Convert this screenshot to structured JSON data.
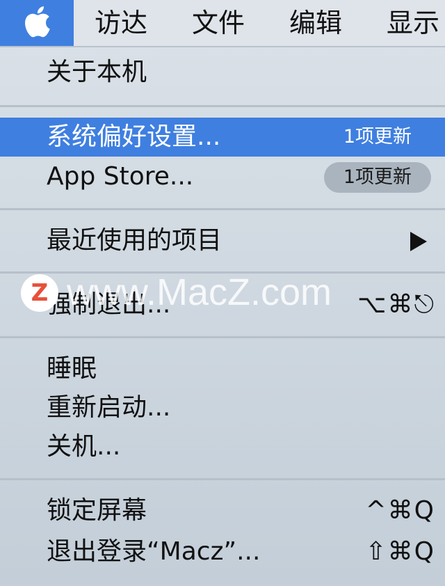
{
  "menubar": {
    "apple_icon": "apple-logo-icon",
    "items": [
      "访达",
      "文件",
      "编辑",
      "显示"
    ]
  },
  "apple_menu": {
    "about": "关于本机",
    "system_prefs": {
      "label": "系统偏好设置...",
      "badge": "1项更新"
    },
    "app_store": {
      "label": "App Store...",
      "badge": "1项更新"
    },
    "recent_items": {
      "label": "最近使用的项目",
      "submenu_icon": "triangle-right-icon"
    },
    "force_quit": {
      "label": "强制退出...",
      "shortcut": "⌥⌘⎋"
    },
    "sleep": "睡眠",
    "restart": "重新启动...",
    "shutdown": "关机...",
    "lock_screen": {
      "label": "锁定屏幕",
      "shortcut": "^⌘Q"
    },
    "logout": {
      "label": "退出登录“Macz”...",
      "shortcut": "⇧⌘Q"
    }
  },
  "watermark": {
    "logo_letter": "Z",
    "text": "www.MacZ.com"
  },
  "colors": {
    "highlight": "#3f7fe0",
    "menu_bg": "#d9e0e7",
    "separator": "#b6c0ca"
  }
}
